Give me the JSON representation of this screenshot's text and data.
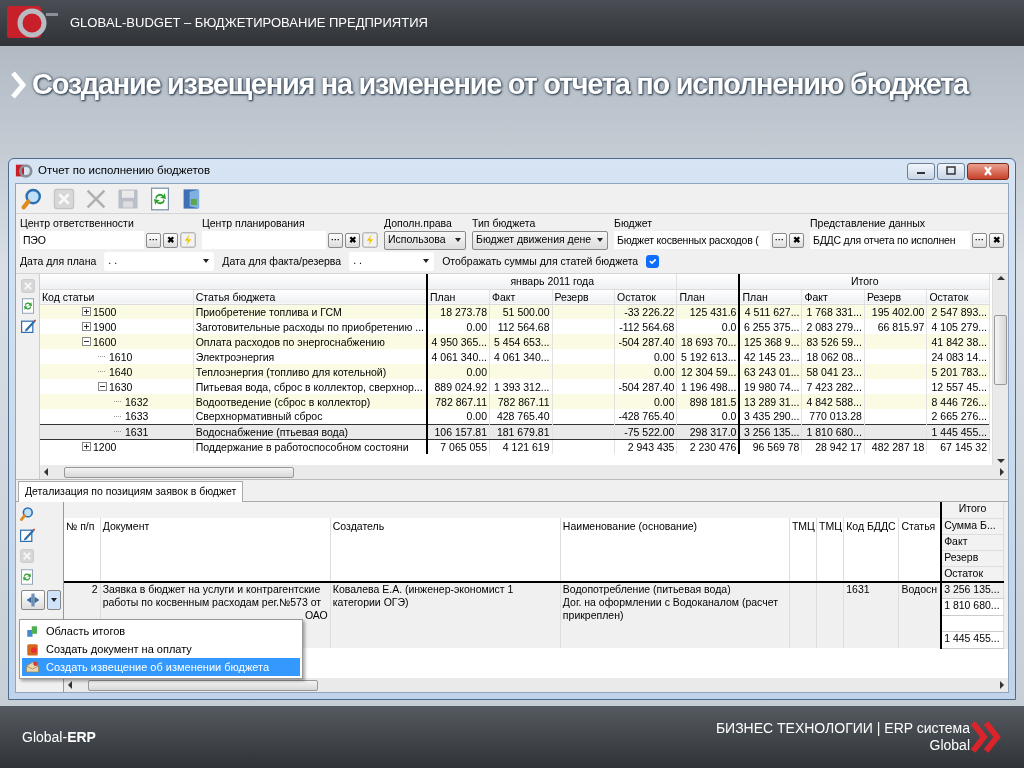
{
  "header": {
    "brand": "GLOBAL-BUDGET – БЮДЖЕТИРОВАНИЕ ПРЕДПРИЯТИЯ"
  },
  "page_title": "Создание извещения на изменение от отчета по исполнению бюджета",
  "window": {
    "title": "Отчет по исполнению бюджетов"
  },
  "toolbar": [
    {
      "kind": "search",
      "disabled": false
    },
    {
      "kind": "clear",
      "disabled": true
    },
    {
      "kind": "delete",
      "disabled": true
    },
    {
      "kind": "save",
      "disabled": true
    },
    {
      "kind": "refresh",
      "disabled": false
    },
    {
      "kind": "exit",
      "disabled": false
    }
  ],
  "filters": [
    {
      "kind": "lookup",
      "label": "Центр ответственности",
      "value": "ПЭО",
      "buttons": [
        "···",
        "✖"
      ],
      "pick": true
    },
    {
      "kind": "lookup",
      "label": "Центр планирования",
      "buttons": [
        "···",
        "✖"
      ],
      "pick": true
    },
    {
      "kind": "select",
      "label": "Дополн.права",
      "value": "Использова"
    },
    {
      "kind": "select",
      "label": "Тип бюджета",
      "value": "Бюджет движения дене"
    },
    {
      "kind": "lookup",
      "label": "Бюджет",
      "value": "Бюджет косвенных расходов (",
      "buttons": [
        "···",
        "✖"
      ],
      "pick": false
    },
    {
      "kind": "lookup",
      "label": "Представление данных",
      "value": "БДДС для отчета по исполнен",
      "buttons": [
        "···",
        "✖"
      ],
      "pick": false
    }
  ],
  "filters_row2": [
    {
      "kind": "date",
      "label": "Дата для плана",
      "value": ". ."
    },
    {
      "kind": "date",
      "label": "Дата для факта/резерва",
      "value": ". ."
    },
    {
      "kind": "checkbox",
      "label": "Отображать суммы для статей бюджета",
      "checked": true
    }
  ],
  "budget_grid": {
    "side_tools": [
      {
        "kind": "clear",
        "disabled": true
      },
      {
        "kind": "refresh",
        "disabled": false
      },
      {
        "kind": "edit",
        "disabled": false
      }
    ],
    "group_headers": [
      "январь  2011 года",
      "Итого"
    ],
    "columns": [
      "Код статьи",
      "Статья бюджета",
      "План",
      "Факт",
      "Резерв",
      "Остаток",
      "План",
      "План",
      "Факт",
      "Резерв",
      "Остаток"
    ],
    "rows": [
      {
        "code": "1500",
        "name": "Приобретение топлива и ГСМ",
        "expanded": false,
        "selected": false,
        "values": {
          "plan": "18 273.78",
          "fact": "51 500.00",
          "remainder": "-33 226.22",
          "plan_next": "125 431.6",
          "total_plan": "4 511 627...",
          "total_fact": "1 768 331...",
          "total_reserve": "195 402.00",
          "total_remainder": "2 547 893..."
        }
      },
      {
        "code": "1900",
        "name": "Заготовительные расходы по приобретению ...",
        "expanded": false,
        "selected": false,
        "values": {
          "plan": "0.00",
          "fact": "112 564.68",
          "remainder": "-112 564.68",
          "plan_next": "0.0",
          "total_plan": "6 255 375...",
          "total_fact": "2 083 279...",
          "total_reserve": "66 815.97",
          "total_remainder": "4 105 279..."
        }
      },
      {
        "code": "1600",
        "name": "Оплата расходов по энергоснабжению",
        "expanded": true,
        "selected": false,
        "values": {
          "plan": "4 950 365...",
          "fact": "5 454 653...",
          "remainder": "-504 287.40",
          "plan_next": "18 693 70...",
          "total_plan": "125 368 9...",
          "total_fact": "83 526 59...",
          "total_remainder": "41 842 38..."
        },
        "children": [
          {
            "code": "1610",
            "name": "Электроэнергия",
            "selected": false,
            "values": {
              "plan": "4 061 340...",
              "fact": "4 061 340...",
              "remainder": "0.00",
              "plan_next": "5 192 613...",
              "total_plan": "42 145 23...",
              "total_fact": "18 062 08...",
              "total_remainder": "24 083 14..."
            }
          },
          {
            "code": "1640",
            "name": "Теплоэнергия (топливо для котельной)",
            "selected": false,
            "values": {
              "plan": "0.00",
              "remainder": "0.00",
              "plan_next": "12 304 59...",
              "total_plan": "63 243 01...",
              "total_fact": "58 041 23...",
              "total_remainder": "5 201 783..."
            }
          },
          {
            "code": "1630",
            "name": "Питьевая вода, сброс в коллектор, сверхнор...",
            "expanded": true,
            "selected": false,
            "values": {
              "plan": "889 024.92",
              "fact": "1 393 312...",
              "remainder": "-504 287.40",
              "plan_next": "1 196 498...",
              "total_plan": "19 980 74...",
              "total_fact": "7 423 282...",
              "total_remainder": "12 557 45..."
            },
            "children": [
              {
                "code": "1632",
                "name": "Водоотведение (сброс в коллектор)",
                "selected": false,
                "values": {
                  "plan": "782 867.11",
                  "fact": "782 867.11",
                  "remainder": "0.00",
                  "plan_next": "898 181.5",
                  "total_plan": "13 289 31...",
                  "total_fact": "4 842 588...",
                  "total_remainder": "8 446 726..."
                }
              },
              {
                "code": "1633",
                "name": "Сверхнормативный сброс",
                "selected": false,
                "values": {
                  "plan": "0.00",
                  "fact": "428 765.40",
                  "remainder": "-428 765.40",
                  "plan_next": "0.0",
                  "total_plan": "3 435 290...",
                  "total_fact": "770 013.28",
                  "total_remainder": "2 665 276..."
                }
              },
              {
                "code": "1631",
                "name": "Водоснабжение (птьевая вода)",
                "selected": true,
                "values": {
                  "plan": "106 157.81",
                  "fact": "181 679.81",
                  "remainder": "-75 522.00",
                  "plan_next": "298 317.0",
                  "total_plan": "3 256 135...",
                  "total_fact": "1 810 680...",
                  "total_remainder": "1 445 455..."
                }
              }
            ]
          }
        ]
      },
      {
        "code": "1200",
        "name": "Поддержание в работоспособном состояни",
        "expanded": false,
        "selected": false,
        "values": {
          "plan": "7 065 055",
          "fact": "4 121 619",
          "remainder": "2 943 435",
          "plan_next": "2 230 476",
          "total_plan": "96 569 78",
          "total_fact": "28 942 17",
          "total_reserve": "482 287 18",
          "total_remainder": "67 145 32"
        }
      }
    ]
  },
  "detail": {
    "tabs": [
      {
        "label": "Детализация по позициям заявок в бюджет",
        "selected": true
      }
    ],
    "side_tools": [
      {
        "kind": "search",
        "disabled": false
      },
      {
        "kind": "edit",
        "disabled": false
      },
      {
        "kind": "clear",
        "disabled": true
      },
      {
        "kind": "refresh",
        "disabled": false
      }
    ],
    "action_menu_open": true,
    "group_header": "Итого",
    "columns": [
      "№ п/п",
      "Документ",
      "Создатель",
      "Наименование (основание)",
      "ТМЦ",
      "ТМЦ",
      "Код БДДС",
      "Статья"
    ],
    "total_columns": [
      "Сумма Б...",
      "Факт",
      "Резерв",
      "Остаток"
    ],
    "rows": [
      {
        "number": "2",
        "document": "Заявка в бюджет на услуги и контрагентские работы по косвенным расходам рег.№573 от",
        "document_tail": "ОАО",
        "creator": "Ковалева Е.А. (инженер-экономист 1 категории ОГЭ)",
        "basis": [
          "Водопотребление (питьевая  вода)",
          "Дог. на оформлении с Водоканалом (расчет прикреплен)"
        ],
        "code": "1631",
        "article": "Водосн",
        "totals": {
          "sum": "3 256 135...",
          "fact": "1 810 680...",
          "remainder": "1 445 455..."
        }
      }
    ],
    "menu": [
      {
        "kind": "summary",
        "label": "Область итогов",
        "selected": false
      },
      {
        "kind": "payment",
        "label": "Создать документ на оплату",
        "selected": false
      },
      {
        "kind": "notice",
        "label": "Создать извещение об изменении бюджета",
        "selected": true
      }
    ]
  },
  "footer": {
    "left": "Global-**ERP**",
    "right": [
      "БИЗНЕС ТЕХНОЛОГИИ | ERP система",
      "Global"
    ]
  }
}
